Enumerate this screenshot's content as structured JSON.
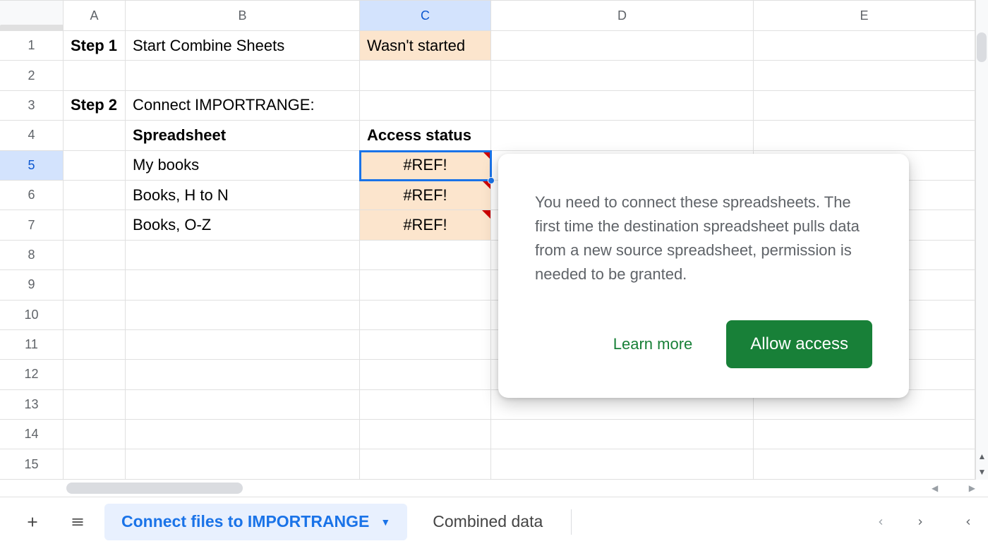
{
  "columns": {
    "A": "A",
    "B": "B",
    "C": "C",
    "D": "D",
    "E": "E"
  },
  "selected_column": "C",
  "selected_row": 5,
  "row_count": 15,
  "cells": {
    "r1": {
      "A": "Step 1",
      "B": "Start Combine Sheets",
      "C": "Wasn't started"
    },
    "r3": {
      "A": "Step 2",
      "B": "Connect IMPORTRANGE:"
    },
    "r4": {
      "B": "Spreadsheet",
      "C": "Access status"
    },
    "r5": {
      "B": "My books",
      "C": "#REF!"
    },
    "r6": {
      "B": "Books, H to N",
      "C": "#REF!"
    },
    "r7": {
      "B": "Books, O-Z",
      "C": "#REF!"
    }
  },
  "popup": {
    "text": "You need to connect these spreadsheets. The first time the destination spreadsheet pulls data from a new source spreadsheet, permission is needed to be granted.",
    "learn": "Learn more",
    "allow": "Allow access"
  },
  "tabs": {
    "active": "Connect files to IMPORTRANGE",
    "other": "Combined data"
  }
}
